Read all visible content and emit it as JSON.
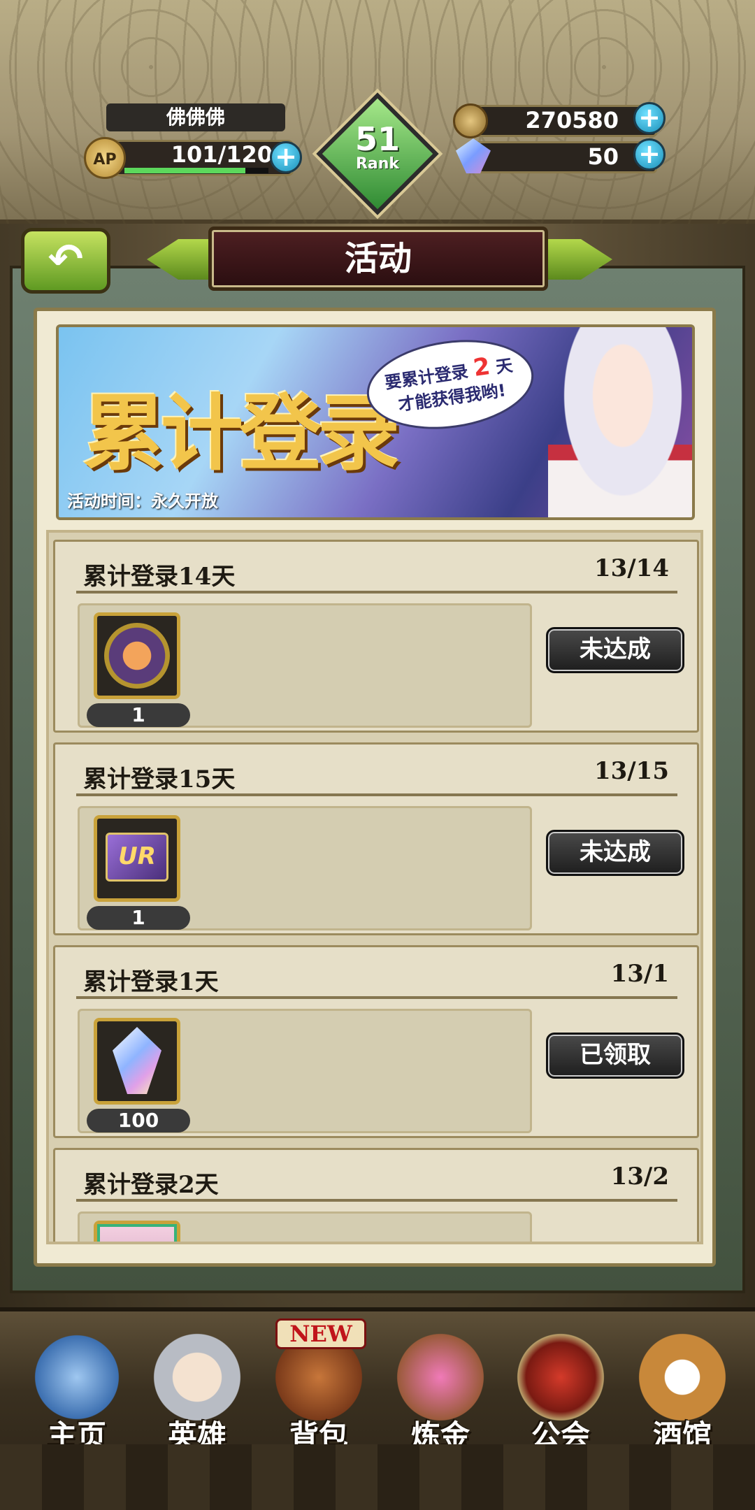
{
  "header": {
    "player_name": "佛佛佛",
    "ap_label": "AP",
    "ap_value": "101/120",
    "ap_fraction": 0.84,
    "rank_number": "51",
    "rank_label": "Rank",
    "gold": "270580",
    "gems": "50",
    "plus_symbol": "+"
  },
  "title_bar": {
    "back_icon": "back-arrow-icon",
    "back_glyph": "↶",
    "title": "活动"
  },
  "banner": {
    "title": "累计登录",
    "bubble_line1": "要累计登录",
    "bubble_days": "2",
    "bubble_unit": "天",
    "bubble_line2": "才能获得我哟!",
    "time_label": "活动时间：永久开放"
  },
  "rewards": [
    {
      "title": "累计登录14天",
      "progress": "13/14",
      "item_icon": "crest-icon",
      "quantity": "1",
      "status": "未达成"
    },
    {
      "title": "累计登录15天",
      "progress": "13/15",
      "item_icon": "ur-ticket-icon",
      "item_text": "UR",
      "quantity": "1",
      "status": "未达成"
    },
    {
      "title": "累计登录1天",
      "progress": "13/1",
      "item_icon": "crystal-icon",
      "quantity": "100",
      "status": "已领取"
    },
    {
      "title": "累计登录2天",
      "progress": "13/2",
      "item_icon": "hero-card-icon"
    }
  ],
  "nav": {
    "home": "主页",
    "heroes": "英雄",
    "bag": "背包",
    "bag_badge": "NEW",
    "alchemy": "炼金",
    "guild": "公会",
    "tavern": "酒馆"
  },
  "colors": {
    "accent_green": "#5cd85c",
    "plus_blue": "#1a8fb8",
    "title_maroon": "#4e1f22",
    "gold_text": "#f2c54b"
  }
}
